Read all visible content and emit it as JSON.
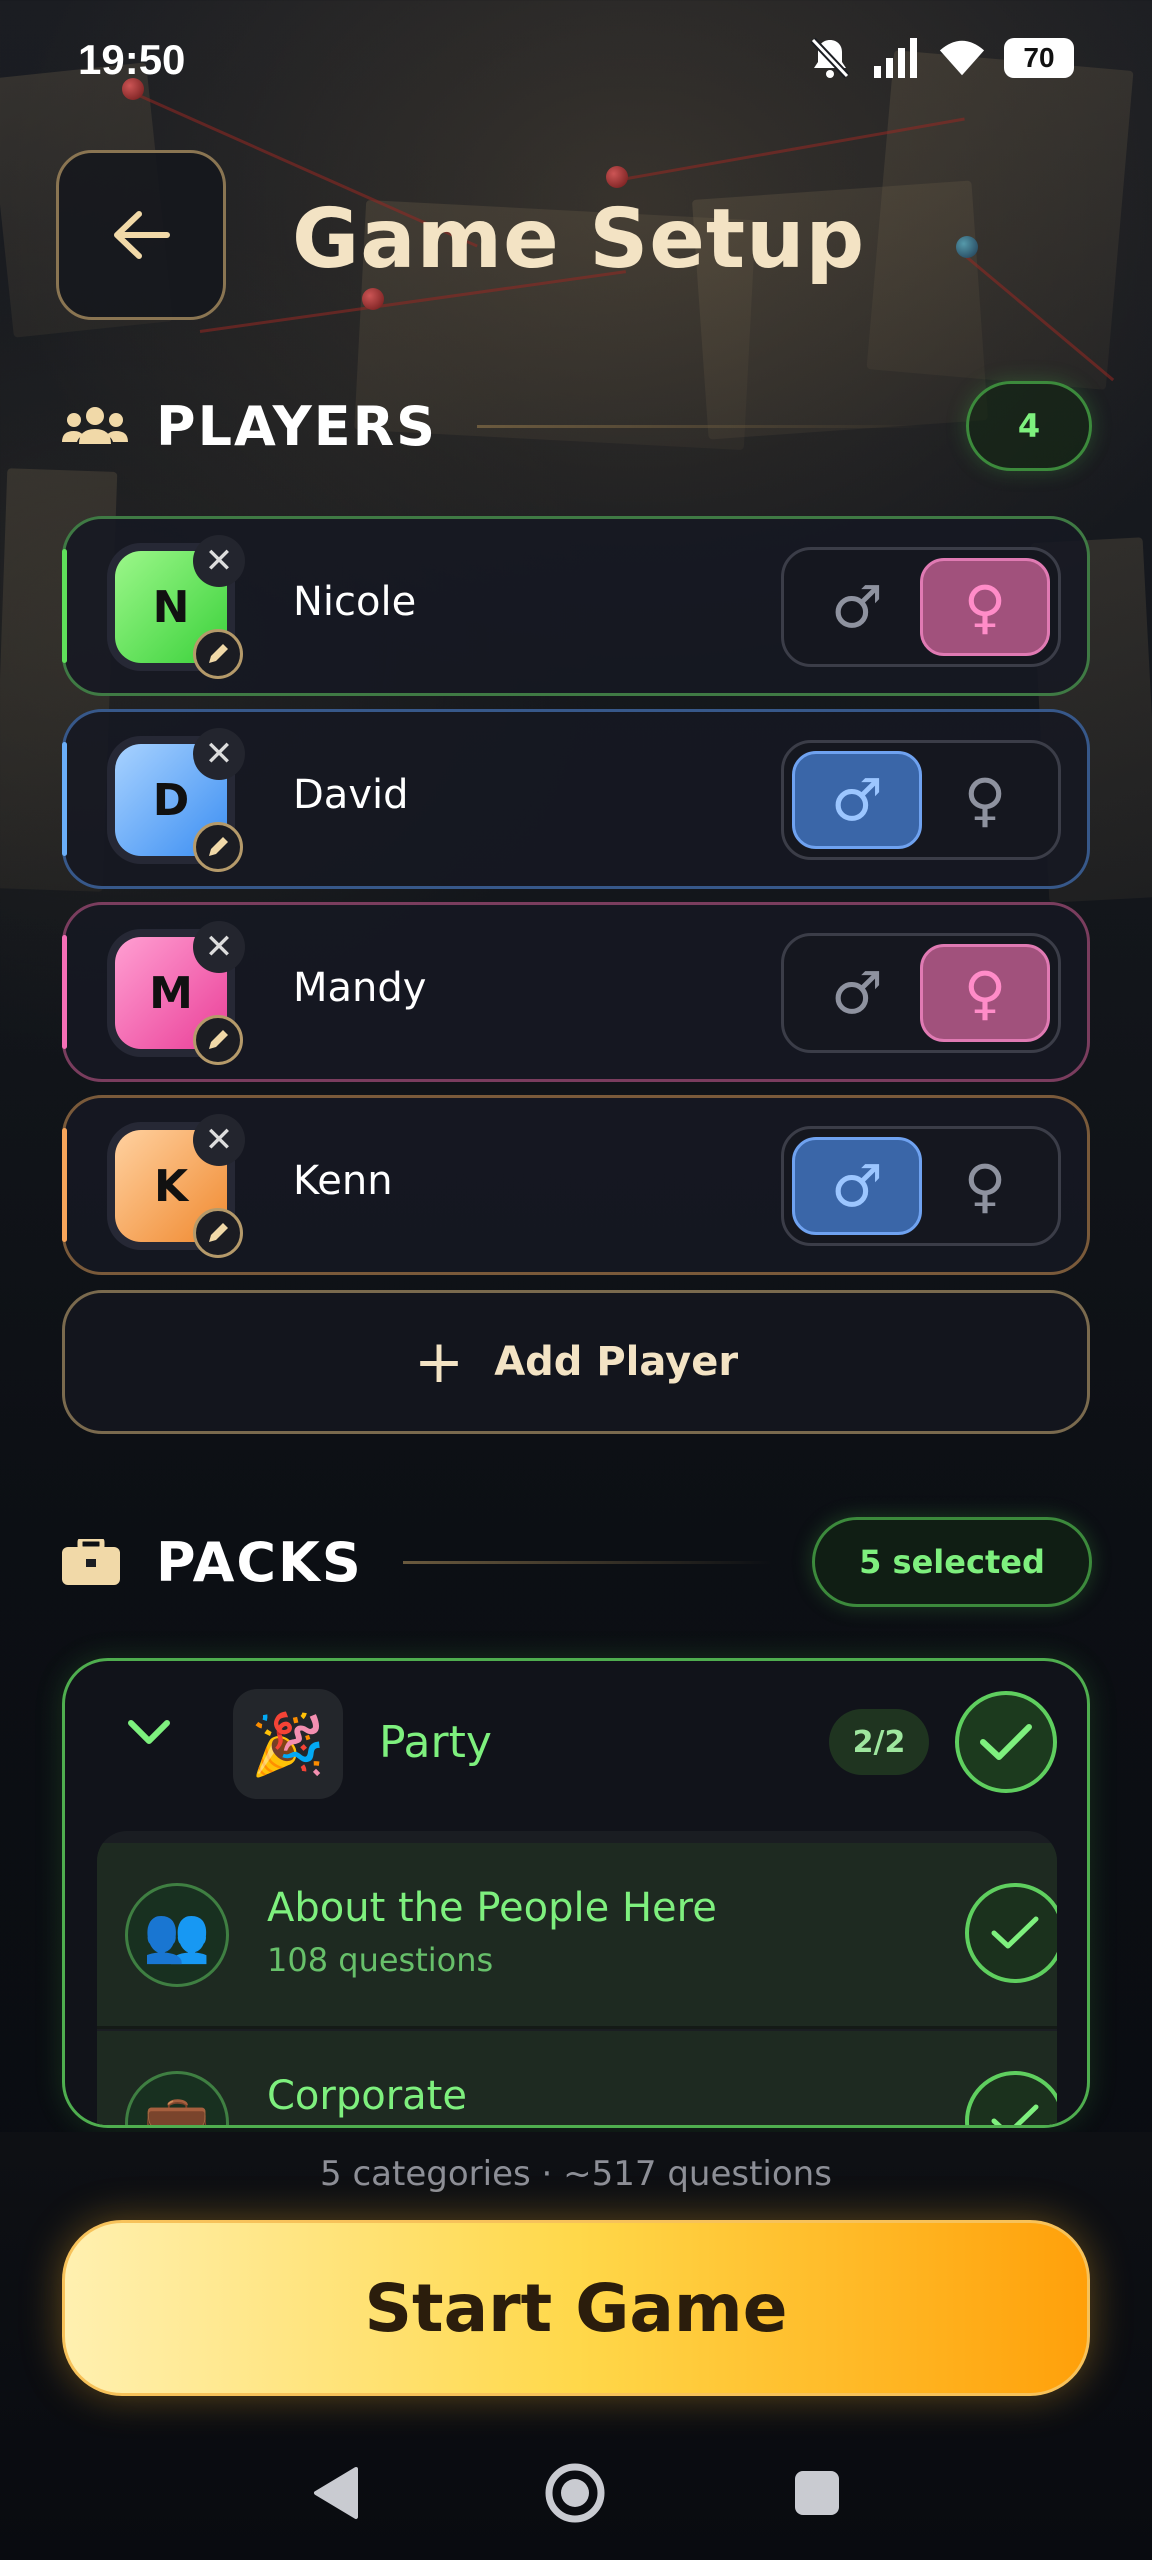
{
  "status_bar": {
    "time": "19:50",
    "battery": "70"
  },
  "header": {
    "title": "Game Setup"
  },
  "players_section": {
    "title": "PLAYERS",
    "count": "4"
  },
  "players": [
    {
      "initial": "N",
      "name": "Nicole",
      "gender": "female"
    },
    {
      "initial": "D",
      "name": "David",
      "gender": "male"
    },
    {
      "initial": "M",
      "name": "Mandy",
      "gender": "female"
    },
    {
      "initial": "K",
      "name": "Kenn",
      "gender": "male"
    }
  ],
  "icons": {
    "remove": "✕",
    "male": "♂",
    "female": "♀"
  },
  "add_player": {
    "icon": "+",
    "label": "Add Player"
  },
  "packs_section": {
    "title": "PACKS",
    "selected": "5 selected"
  },
  "pack": {
    "emoji": "🎉",
    "name": "Party",
    "count": "2/2",
    "items": [
      {
        "emoji": "👥",
        "title": "About the People Here",
        "desc": "108 questions"
      },
      {
        "emoji": "💼",
        "title": "Corporate",
        "desc": ""
      }
    ]
  },
  "summary": "5 categories · ~517 questions",
  "start_button": "Start Game",
  "colors": {
    "green": "#7ef07e",
    "nicole": "#5fe05a",
    "david": "#6aaef8",
    "mandy": "#f56fb6",
    "kenn": "#f8a55a"
  }
}
